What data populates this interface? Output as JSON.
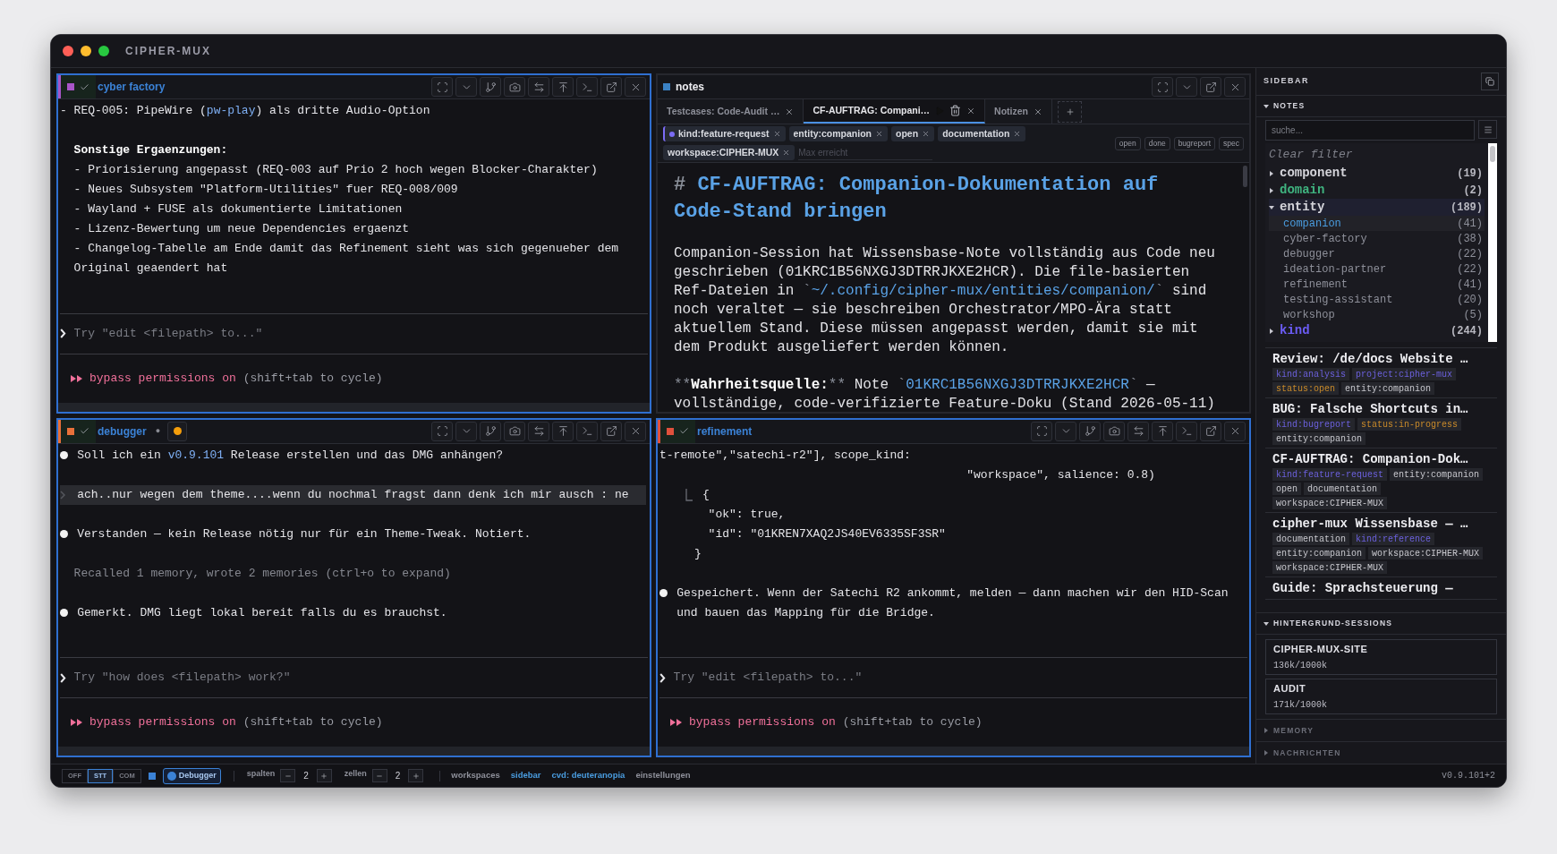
{
  "window": {
    "title": "CIPHER-MUX"
  },
  "panes": [
    {
      "kind": "terminal",
      "title": "cyber factory",
      "color": "#a855c8",
      "focused": true,
      "lines": [
        {
          "kind": "flush",
          "parts": [
            {
              "text": "- REQ-005: PipeWire ("
            },
            {
              "text": "pw-play",
              "kind": "accent"
            },
            {
              "text": ") als dritte Audio-Option"
            }
          ]
        },
        {
          "kind": "blank"
        },
        {
          "kind": "text",
          "parts": [
            {
              "text": "Sonstige Ergaenzungen:",
              "kind": "strong"
            }
          ]
        },
        {
          "kind": "text",
          "parts": [
            {
              "text": "- Priorisierung angepasst (REQ-003 auf Prio 2 hoch wegen Blocker-Charakter)"
            }
          ]
        },
        {
          "kind": "text",
          "parts": [
            {
              "text": "- Neues Subsystem \"Platform-Utilities\" fuer REQ-008/009"
            }
          ]
        },
        {
          "kind": "text",
          "parts": [
            {
              "text": "- Wayland + FUSE als dokumentierte Limitationen"
            }
          ]
        },
        {
          "kind": "text",
          "parts": [
            {
              "text": "- Lizenz-Bewertung um neue Dependencies ergaenzt"
            }
          ]
        },
        {
          "kind": "text",
          "parts": [
            {
              "text": "- Changelog-Tabelle am Ende damit das Refinement sieht was sich gegenueber dem Original geaendert hat"
            }
          ]
        }
      ],
      "prompt": {
        "placeholder": "Try \"edit <filepath> to...\""
      },
      "mode": {
        "label": "bypass permissions on",
        "hint": "(shift+tab to cycle)"
      }
    },
    {
      "kind": "notes",
      "title": "notes",
      "color": "#3b82c4",
      "focused": false,
      "tabs": [
        {
          "label": "Testcases: Code-Audit …",
          "selected": false
        },
        {
          "label": "CF-AUFTRAG: Compani…",
          "selected": true
        },
        {
          "label": "Notizen",
          "selected": false
        }
      ],
      "tags": [
        {
          "label": "kind:feature-request",
          "color": "#7b6cf6"
        },
        {
          "label": "entity:companion"
        },
        {
          "label": "open"
        },
        {
          "label": "documentation"
        },
        {
          "label": "workspace:CIPHER-MUX"
        }
      ],
      "tag_input": {
        "placeholder": "Max erreicht"
      },
      "quick_tags": [
        "open",
        "done",
        "bugreport",
        "spec"
      ],
      "document": {
        "heading": {
          "marker": "#",
          "text": "CF-AUFTRAG: Companion-Dokumentation auf Code-Stand bringen"
        },
        "paragraphs": [
          [
            {
              "text": "Companion-Session hat Wissensbase-Note vollständig aus Code neu geschrieben (01KRC1B56NXGJ3DTRRJKXE2HCR). Die file-basierten Ref-Dateien in "
            },
            {
              "text": "`",
              "kind": "syntax"
            },
            {
              "text": "~/.config/cipher-mux/entities/companion/",
              "kind": "code"
            },
            {
              "text": "`",
              "kind": "syntax"
            },
            {
              "text": " sind noch veraltet — sie beschreiben Orchestrator/MPO-Ära statt aktuellem Stand. Diese müssen angepasst werden, damit sie mit dem Produkt ausgeliefert werden können."
            }
          ],
          [
            {
              "text": "**",
              "kind": "syntax"
            },
            {
              "text": "Wahrheitsquelle:",
              "kind": "strong"
            },
            {
              "text": "**",
              "kind": "syntax"
            },
            {
              "text": " Note "
            },
            {
              "text": "`",
              "kind": "syntax"
            },
            {
              "text": "01KRC1B56NXGJ3DTRRJKXE2HCR",
              "kind": "code"
            },
            {
              "text": "`",
              "kind": "syntax"
            },
            {
              "text": " — vollständige, code-verifizierte Feature-Doku (Stand 2026-05-11)"
            }
          ]
        ]
      }
    },
    {
      "kind": "terminal",
      "title": "debugger",
      "color": "#e8703a",
      "focused": true,
      "badge": "●",
      "alert": true,
      "lines": [
        {
          "kind": "bullet",
          "parts": [
            {
              "text": "Soll ich ein "
            },
            {
              "text": "v0.9.101",
              "kind": "accent"
            },
            {
              "text": " Release erstellen und das DMG anhängen?"
            }
          ]
        },
        {
          "kind": "blank"
        },
        {
          "kind": "user",
          "parts": [
            {
              "text": "ach..nur wegen dem theme....wenn du nochmal fragst dann denk ich mir ausch : ne"
            }
          ]
        },
        {
          "kind": "blank"
        },
        {
          "kind": "bullet",
          "parts": [
            {
              "text": "Verstanden — kein Release nötig nur für ein Theme-Tweak. Notiert."
            }
          ]
        },
        {
          "kind": "blank"
        },
        {
          "kind": "dim",
          "parts": [
            {
              "text": "Recalled 1 memory, wrote 2 memories (ctrl+o to expand)"
            }
          ]
        },
        {
          "kind": "blank"
        },
        {
          "kind": "bullet",
          "parts": [
            {
              "text": "Gemerkt. DMG liegt lokal bereit falls du es brauchst."
            }
          ]
        }
      ],
      "prompt": {
        "placeholder": "Try \"how does <filepath> work?\""
      },
      "mode": {
        "label": "bypass permissions on",
        "hint": "(shift+tab to cycle)"
      }
    },
    {
      "kind": "terminal",
      "title": "refinement",
      "color": "#e0503c",
      "focused": true,
      "lines": [
        {
          "kind": "flush",
          "parts": [
            {
              "text": "t-remote\",\"satechi-r2\"], scope_kind:"
            }
          ]
        },
        {
          "kind": "hanging",
          "parts": [
            {
              "text": "\"workspace\", salience: 0.8)"
            }
          ]
        },
        {
          "kind": "tree_open",
          "parts": [
            {
              "text": "{"
            }
          ]
        },
        {
          "kind": "code_inner",
          "parts": [
            {
              "text": "\"ok\": true,"
            }
          ]
        },
        {
          "kind": "code_inner",
          "parts": [
            {
              "text": "\"id\": \"01KREN7XAQ2JS40EV6335SF3SR\""
            }
          ]
        },
        {
          "kind": "code_close",
          "parts": [
            {
              "text": "}"
            }
          ]
        },
        {
          "kind": "blank"
        },
        {
          "kind": "bullet",
          "parts": [
            {
              "text": "Gespeichert. Wenn der Satechi R2 ankommt, melden — dann machen wir den HID-Scan und bauen das Mapping für die Bridge."
            }
          ]
        }
      ],
      "prompt": {
        "placeholder": "Try \"edit <filepath> to...\""
      },
      "mode": {
        "label": "bypass permissions on",
        "hint": "(shift+tab to cycle)"
      }
    }
  ],
  "sidebar": {
    "title": "SIDEBAR",
    "sections": [
      {
        "kind": "notes",
        "title": "NOTES",
        "expanded": true,
        "search": {
          "placeholder": "suche..."
        },
        "clear_filter": "Clear filter",
        "tree": [
          {
            "label": "component",
            "count": "(19)",
            "expanded": false,
            "color": "#d4d4da"
          },
          {
            "label": "domain",
            "count": "(2)",
            "expanded": false,
            "color": "#3fb37f"
          },
          {
            "label": "entity",
            "count": "(189)",
            "expanded": true,
            "color": "#d4d4da",
            "children": [
              {
                "label": "companion",
                "count": "(41)",
                "selected": true
              },
              {
                "label": "cyber-factory",
                "count": "(38)",
                "selected": false
              },
              {
                "label": "debugger",
                "count": "(22)",
                "selected": false
              },
              {
                "label": "ideation-partner",
                "count": "(22)",
                "selected": false
              },
              {
                "label": "refinement",
                "count": "(41)",
                "selected": false
              },
              {
                "label": "testing-assistant",
                "count": "(20)",
                "selected": false
              },
              {
                "label": "workshop",
                "count": "(5)",
                "selected": false
              }
            ]
          },
          {
            "label": "kind",
            "count": "(244)",
            "expanded": false,
            "color": "#6b5cf5"
          }
        ],
        "cards": [
          {
            "title": "Review: /de/docs Website …",
            "tags": [
              {
                "label": "kind:analysis",
                "kind": "category"
              },
              {
                "label": "project:cipher-mux",
                "kind": "category"
              },
              {
                "label": "status:open",
                "kind": "status"
              },
              {
                "label": "entity:companion",
                "kind": "plain"
              }
            ]
          },
          {
            "title": "BUG: Falsche Shortcuts in…",
            "tags": [
              {
                "label": "kind:bugreport",
                "kind": "category"
              },
              {
                "label": "status:in-progress",
                "kind": "status"
              },
              {
                "label": "entity:companion",
                "kind": "plain"
              }
            ]
          },
          {
            "title": "CF-AUFTRAG: Companion-Dok…",
            "tags": [
              {
                "label": "kind:feature-request",
                "kind": "category"
              },
              {
                "label": "entity:companion",
                "kind": "plain"
              },
              {
                "label": "open",
                "kind": "plain"
              },
              {
                "label": "documentation",
                "kind": "plain"
              },
              {
                "label": "workspace:CIPHER-MUX",
                "kind": "plain"
              }
            ]
          },
          {
            "title": "cipher-mux Wissensbase — …",
            "tags": [
              {
                "label": "documentation",
                "kind": "plain"
              },
              {
                "label": "kind:reference",
                "kind": "category"
              },
              {
                "label": "entity:companion",
                "kind": "plain"
              },
              {
                "label": "workspace:CIPHER-MUX",
                "kind": "plain"
              },
              {
                "label": "workspace:CIPHER-MUX",
                "kind": "plain"
              }
            ]
          },
          {
            "title": "Guide: Sprachsteuerung —"
          }
        ]
      },
      {
        "kind": "sessions",
        "title": "HINTERGRUND-SESSIONS",
        "expanded": true,
        "sessions": [
          {
            "name": "CIPHER-MUX-SITE",
            "usage": "136k/1000k"
          },
          {
            "name": "AUDIT",
            "usage": "171k/1000k"
          }
        ]
      },
      {
        "kind": "memory",
        "title": "MEMORY",
        "expanded": false
      },
      {
        "kind": "messages",
        "title": "NACHRICHTEN",
        "expanded": false
      }
    ]
  },
  "status_bar": {
    "input_modes": [
      {
        "label": "OFF",
        "selected": false
      },
      {
        "label": "STT",
        "selected": true
      },
      {
        "label": "COM",
        "selected": false
      }
    ],
    "active_session": {
      "label": "Debugger"
    },
    "steppers": [
      {
        "label": "spalten",
        "value": "2"
      },
      {
        "label": "zellen",
        "value": "2"
      }
    ],
    "links": [
      {
        "label": "workspaces",
        "active": false
      },
      {
        "label": "sidebar",
        "active": true
      },
      {
        "label": "cvd: deuteranopia",
        "active": true
      },
      {
        "label": "einstellungen",
        "active": false
      }
    ],
    "version": "v0.9.101+2"
  }
}
